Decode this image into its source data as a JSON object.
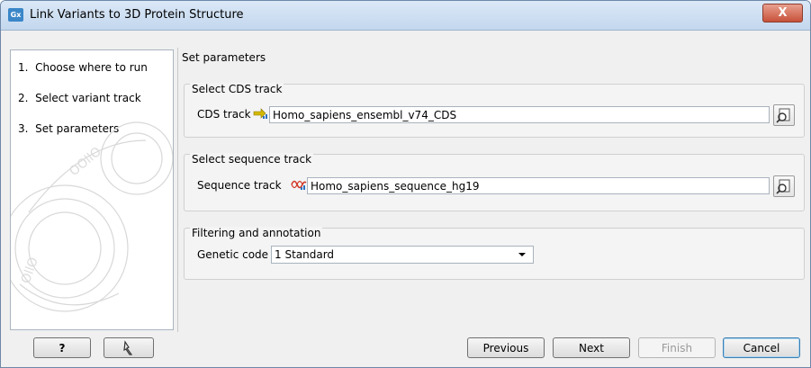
{
  "window": {
    "title": "Link Variants to 3D Protein Structure",
    "app_icon_text": "Gx",
    "close_label": "X"
  },
  "wizard": {
    "steps": [
      {
        "number": "1.",
        "label": "Choose where to run"
      },
      {
        "number": "2.",
        "label": "Select variant track"
      },
      {
        "number": "3.",
        "label": "Set parameters"
      }
    ]
  },
  "content": {
    "header": "Set parameters",
    "cds_group": {
      "title": "Select CDS track",
      "label": "CDS track",
      "value": "Homo_sapiens_ensembl_v74_CDS"
    },
    "sequence_group": {
      "title": "Select sequence track",
      "label": "Sequence track",
      "value": "Homo_sapiens_sequence_hg19"
    },
    "filter_group": {
      "title": "Filtering and annotation",
      "label": "Genetic code",
      "value": "1 Standard"
    }
  },
  "buttons": {
    "help": "?",
    "previous": "Previous",
    "next": "Next",
    "finish": "Finish",
    "cancel": "Cancel"
  },
  "colors": {
    "titlebar": "#c3d7ee",
    "close": "#c7513a",
    "cds_icon": "#d4b800",
    "sequence_icon": "#d23a2a",
    "track_dots": "#2c6fc0"
  }
}
